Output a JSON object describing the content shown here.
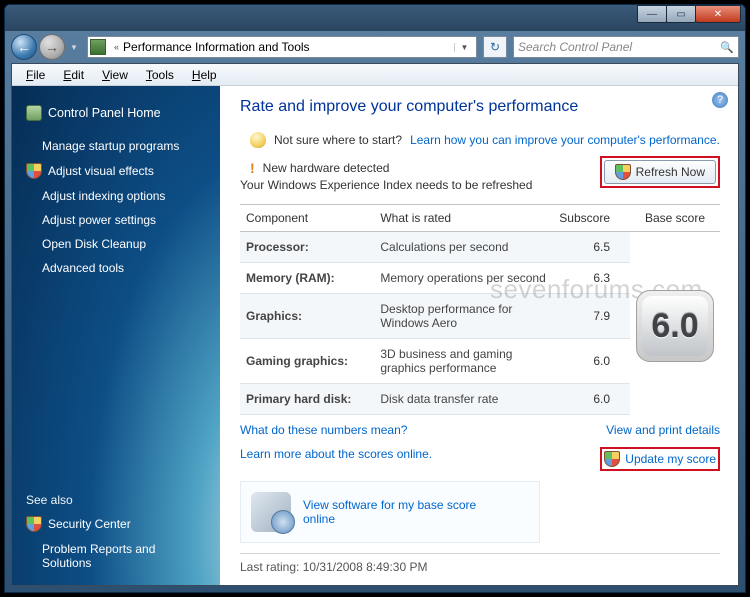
{
  "window": {
    "address_crumb_prefix": "«",
    "address_crumb": "Performance Information and Tools",
    "search_placeholder": "Search Control Panel"
  },
  "menubar": [
    "File",
    "Edit",
    "View",
    "Tools",
    "Help"
  ],
  "sidebar": {
    "home": "Control Panel Home",
    "items": [
      "Manage startup programs",
      "Adjust visual effects",
      "Adjust indexing options",
      "Adjust power settings",
      "Open Disk Cleanup",
      "Advanced tools"
    ],
    "see_also_label": "See also",
    "see_also": [
      "Security Center",
      "Problem Reports and Solutions"
    ]
  },
  "main": {
    "title": "Rate and improve your computer's performance",
    "hint_text": "Not sure where to start?",
    "hint_link": "Learn how you can improve your computer's performance.",
    "hw_detect": "New hardware detected",
    "hw_sub": "Your Windows Experience Index needs to be refreshed",
    "refresh_btn": "Refresh Now",
    "table": {
      "headers": [
        "Component",
        "What is rated",
        "Subscore",
        "Base score"
      ],
      "rows": [
        {
          "comp": "Processor:",
          "rated": "Calculations per second",
          "sub": "6.5"
        },
        {
          "comp": "Memory (RAM):",
          "rated": "Memory operations per second",
          "sub": "6.3"
        },
        {
          "comp": "Graphics:",
          "rated": "Desktop performance for Windows Aero",
          "sub": "7.9"
        },
        {
          "comp": "Gaming graphics:",
          "rated": "3D business and gaming graphics performance",
          "sub": "6.0"
        },
        {
          "comp": "Primary hard disk:",
          "rated": "Disk data transfer rate",
          "sub": "6.0"
        }
      ],
      "base_score": "6.0"
    },
    "link_numbers": "What do these numbers mean?",
    "link_viewprint": "View and print details",
    "link_learn": "Learn more about the scores online.",
    "link_update": "Update my score",
    "soft_link": "View software for my base score online",
    "last_rating_label": "Last rating:",
    "last_rating_value": "10/31/2008 8:49:30 PM"
  },
  "watermark": "sevenforums.com"
}
